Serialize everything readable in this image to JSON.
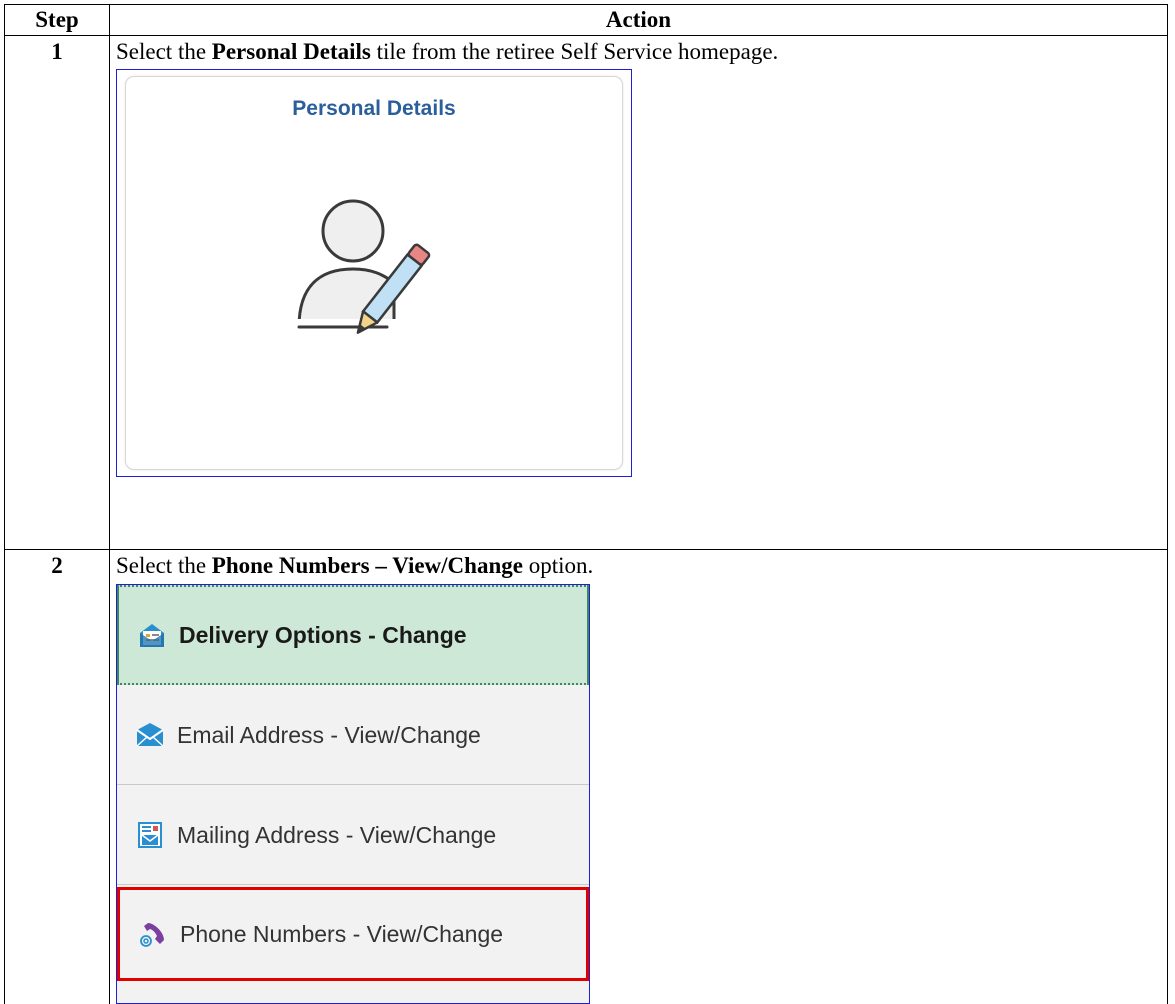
{
  "table": {
    "headers": {
      "step": "Step",
      "action": "Action"
    }
  },
  "steps": [
    {
      "number": "1",
      "text_before": "Select the ",
      "text_bold": "Personal Details",
      "text_after": " tile from the retiree Self Service homepage.",
      "tile": {
        "title": "Personal Details",
        "icon": "person-edit-icon"
      }
    },
    {
      "number": "2",
      "text_before": "Select the ",
      "text_bold": "Phone Numbers – View/Change",
      "text_after": " option.",
      "menu": [
        {
          "label": "Delivery Options - Change",
          "icon": "delivery-options-icon",
          "state": "active"
        },
        {
          "label": "Email Address - View/Change",
          "icon": "envelope-icon",
          "state": "normal"
        },
        {
          "label": "Mailing Address - View/Change",
          "icon": "mailing-address-icon",
          "state": "normal"
        },
        {
          "label": "Phone Numbers - View/Change",
          "icon": "phone-icon",
          "state": "highlighted"
        }
      ]
    }
  ],
  "colors": {
    "tile_title": "#2b5f9c",
    "screenshot_border": "#1f1fd8",
    "active_item_bg": "#cde8d6",
    "highlight_border": "#e00000"
  }
}
